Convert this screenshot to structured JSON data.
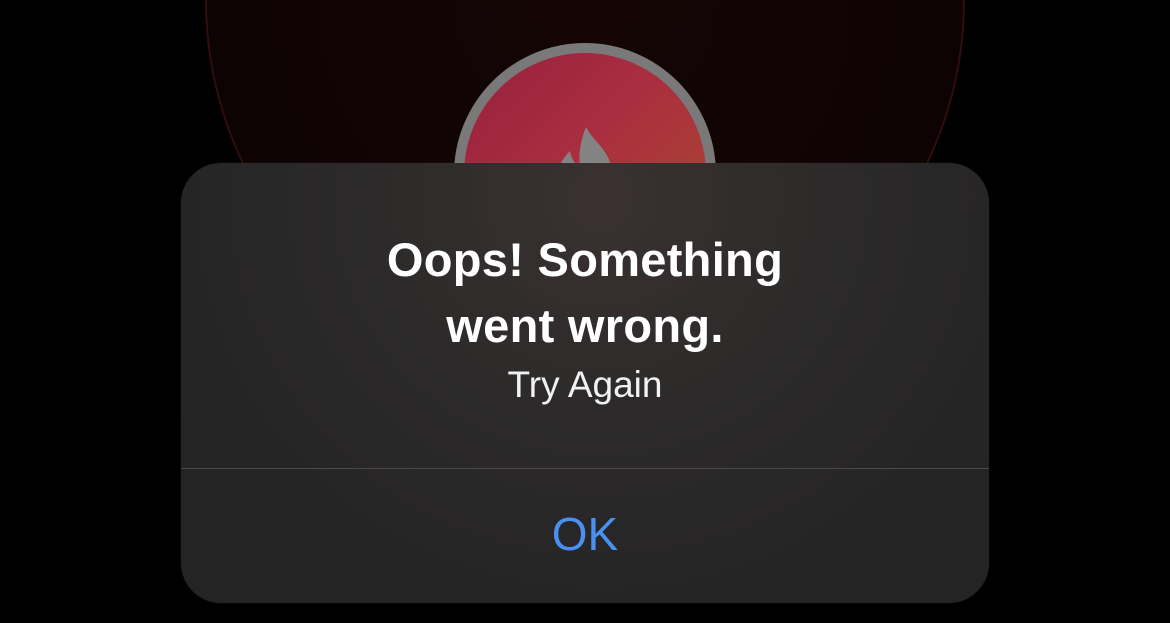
{
  "background": {
    "logo_icon": "flame-icon",
    "accent_gradient": [
      "#b2264c",
      "#c95a38"
    ]
  },
  "alert": {
    "title_lines": [
      "Oops! Something",
      "went wrong."
    ],
    "message": "Try Again",
    "ok_button_label": "OK",
    "button_color": "#4b8ff0"
  }
}
